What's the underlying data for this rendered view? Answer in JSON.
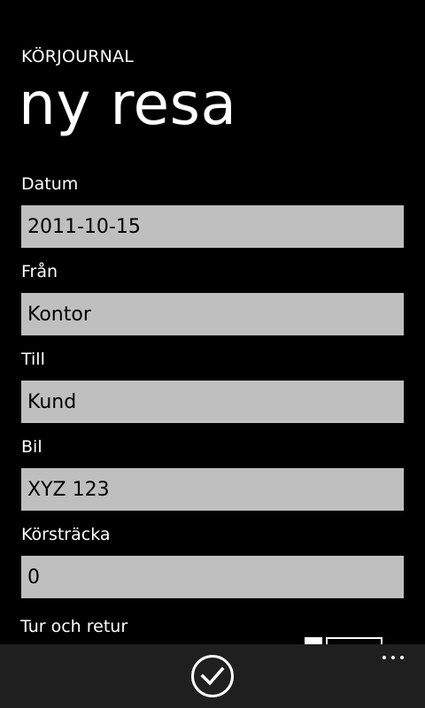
{
  "header": {
    "app_title": "KÖRJOURNAL",
    "page_title": "ny resa"
  },
  "form": {
    "date": {
      "label": "Datum",
      "value": "2011-10-15"
    },
    "from": {
      "label": "Från",
      "value": "Kontor"
    },
    "to": {
      "label": "Till",
      "value": "Kund"
    },
    "car": {
      "label": "Bil",
      "value": "XYZ 123"
    },
    "distance": {
      "label": "Körsträcka",
      "value": "0"
    },
    "round_trip": {
      "label": "Tur och retur",
      "state": "off"
    }
  },
  "app_bar": {
    "primary_icon": "check-icon",
    "more_icon": "ellipsis-icon",
    "background": "#1f1f1f"
  },
  "colors": {
    "background": "#000000",
    "foreground": "#ffffff",
    "input_background": "#bfbfbf",
    "input_text": "#000000"
  }
}
